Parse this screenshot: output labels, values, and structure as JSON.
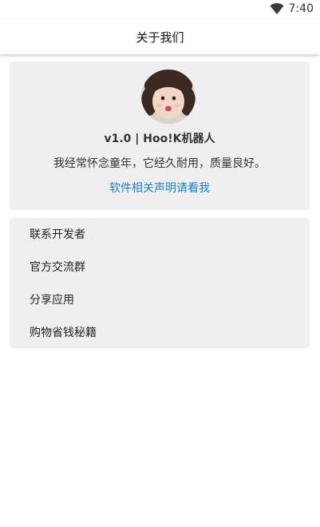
{
  "status_bar": {
    "time": "7:40",
    "wifi_icon": "wifi-icon"
  },
  "app_bar": {
    "title": "关于我们"
  },
  "about": {
    "avatar_icon": "avatar-photo",
    "version": "v1.0 | Hoo!K机器人",
    "slogan": "我经常怀念童年，它经久耐用，质量良好。",
    "statement_link": "软件相关声明请看我",
    "link_color": "#1e7fc6"
  },
  "menu": {
    "items": [
      {
        "label": "联系开发者"
      },
      {
        "label": "官方交流群"
      },
      {
        "label": "分享应用"
      },
      {
        "label": "购物省钱秘籍"
      }
    ]
  }
}
